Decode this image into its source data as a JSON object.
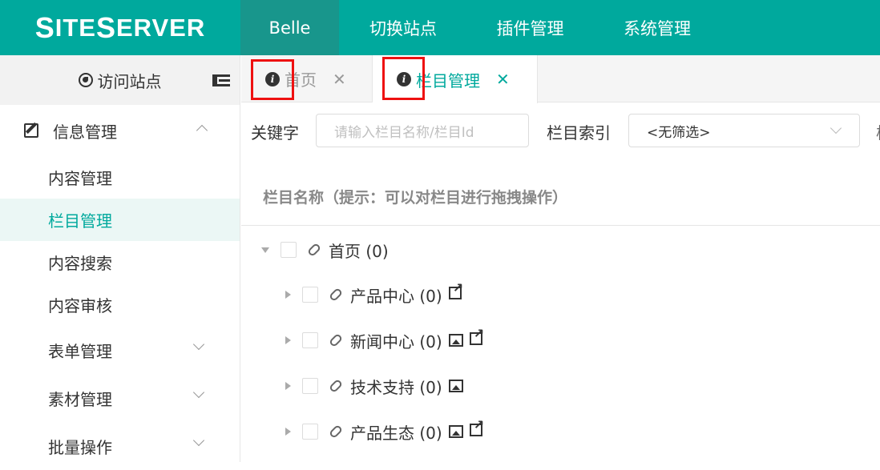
{
  "header": {
    "logo_s": "S",
    "logo_ite": "ITE",
    "logo_s2": "S",
    "logo_erver": "ERVER",
    "nav": [
      {
        "label": "Belle",
        "active": true
      },
      {
        "label": "切换站点"
      },
      {
        "label": "插件管理"
      },
      {
        "label": "系统管理"
      }
    ]
  },
  "sidebar": {
    "visit_label": "访问站点",
    "group_label": "信息管理",
    "items": [
      "内容管理",
      "栏目管理",
      "内容搜索",
      "内容审核"
    ],
    "active_item": "栏目管理",
    "collapsed_groups": [
      "表单管理",
      "素材管理",
      "批量操作"
    ]
  },
  "tabs": [
    {
      "label": "首页",
      "active": false
    },
    {
      "label": "栏目管理",
      "active": true
    }
  ],
  "filter": {
    "keyword_label": "关键字",
    "keyword_placeholder": "请输入栏目名称/栏目Id",
    "index_label": "栏目索引",
    "index_selected": "<无筛选>",
    "extra_label": "栏"
  },
  "tree": {
    "header": "栏目名称（提示：可以对栏目进行拖拽操作）",
    "rows": [
      {
        "label": "首页 (0)",
        "expanded": true,
        "level": 0,
        "image": false,
        "external": false
      },
      {
        "label": "产品中心 (0)",
        "expanded": false,
        "level": 1,
        "image": false,
        "external": true
      },
      {
        "label": "新闻中心 (0)",
        "expanded": false,
        "level": 1,
        "image": true,
        "external": true
      },
      {
        "label": "技术支持 (0)",
        "expanded": false,
        "level": 1,
        "image": true,
        "external": false
      },
      {
        "label": "产品生态 (0)",
        "expanded": false,
        "level": 1,
        "image": true,
        "external": true
      }
    ]
  },
  "colors": {
    "brand": "#00a99d",
    "nav_active": "#18968c",
    "highlight": "#ee1111"
  }
}
